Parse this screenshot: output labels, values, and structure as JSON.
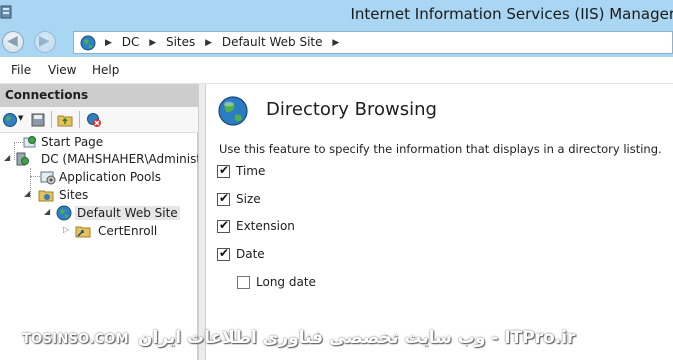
{
  "window": {
    "title": "Internet Information Services (IIS) Manager"
  },
  "address": {
    "crumbs": [
      "DC",
      "Sites",
      "Default Web Site"
    ]
  },
  "menu": {
    "file": "File",
    "view": "View",
    "help": "Help"
  },
  "connections": {
    "header": "Connections",
    "tree": {
      "start_page": "Start Page",
      "server": "DC (MAHSHAHER\\Administrator)",
      "app_pools": "Application Pools",
      "sites": "Sites",
      "default_site": "Default Web Site",
      "cert_enroll": "CertEnroll"
    }
  },
  "feature": {
    "title": "Directory Browsing",
    "description": "Use this feature to specify the information that displays in a directory listing.",
    "options": [
      {
        "label": "Time",
        "checked": true
      },
      {
        "label": "Size",
        "checked": true
      },
      {
        "label": "Extension",
        "checked": true
      },
      {
        "label": "Date",
        "checked": true
      },
      {
        "label": "Long date",
        "checked": false
      }
    ]
  },
  "watermark": {
    "left": "TOSINSO.COM",
    "right": "ITPro.ir - وب سایت تخصصی فناوری اطلاعات ایران"
  },
  "colors": {
    "titlebar": "#a9d6f2",
    "conn_header": "#cdcdcd",
    "selection": "#e6e6e6"
  }
}
